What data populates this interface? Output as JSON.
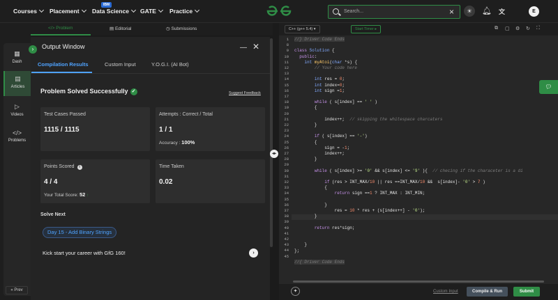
{
  "nav": {
    "items": [
      "Courses",
      "Placement",
      "Data Science",
      "GATE",
      "Practice"
    ],
    "badge": "IBM",
    "search_placeholder": "Search...",
    "avatar_letter": "E"
  },
  "sidebar": {
    "items": [
      "Dash",
      "Articles",
      "Videos",
      "Problems"
    ],
    "prev": "Prev"
  },
  "problem_tabs": [
    "Problem",
    "Editorial",
    "Submissions"
  ],
  "output": {
    "title": "Output Window",
    "tabs": [
      "Compilation Results",
      "Custom Input",
      "Y.O.G.I. (AI Bot)"
    ],
    "status": "Problem Solved Successfully",
    "feedback": "Suggest Feedback",
    "tests_label": "Test Cases Passed",
    "tests_value": "1115 / 1115",
    "attempts_label": "Attempts : Correct / Total",
    "attempts_value": "1 / 1",
    "accuracy_label": "Accuracy :",
    "accuracy_value": "100%",
    "points_label": "Points Scored",
    "points_value": "4 / 4",
    "total_label": "Your Total Score:",
    "total_value": "52",
    "time_label": "Time Taken",
    "time_value": "0.02",
    "solve_next": "Solve Next",
    "next_problem": "Day 15 - Add Binary Strings",
    "kickstart": "Kick start your career with GfG 160!"
  },
  "editor": {
    "language": "C++ (g++ 5.4)",
    "timer": "Start Timer",
    "line_numbers": [
      "1",
      "8",
      "9",
      "10",
      "11",
      "12",
      "13",
      "14",
      "15",
      "16",
      "17",
      "18",
      "19",
      "20",
      "21",
      "22",
      "23",
      "24",
      "25",
      "26",
      "27",
      "28",
      "29",
      "30",
      "31",
      "32",
      "33",
      "34",
      "35",
      "36",
      "37",
      "38",
      "39",
      "40",
      "41",
      "42",
      "43",
      "44",
      "45"
    ],
    "custom_input": "Custom Input",
    "compile": "Compile & Run",
    "submit": "Submit"
  }
}
